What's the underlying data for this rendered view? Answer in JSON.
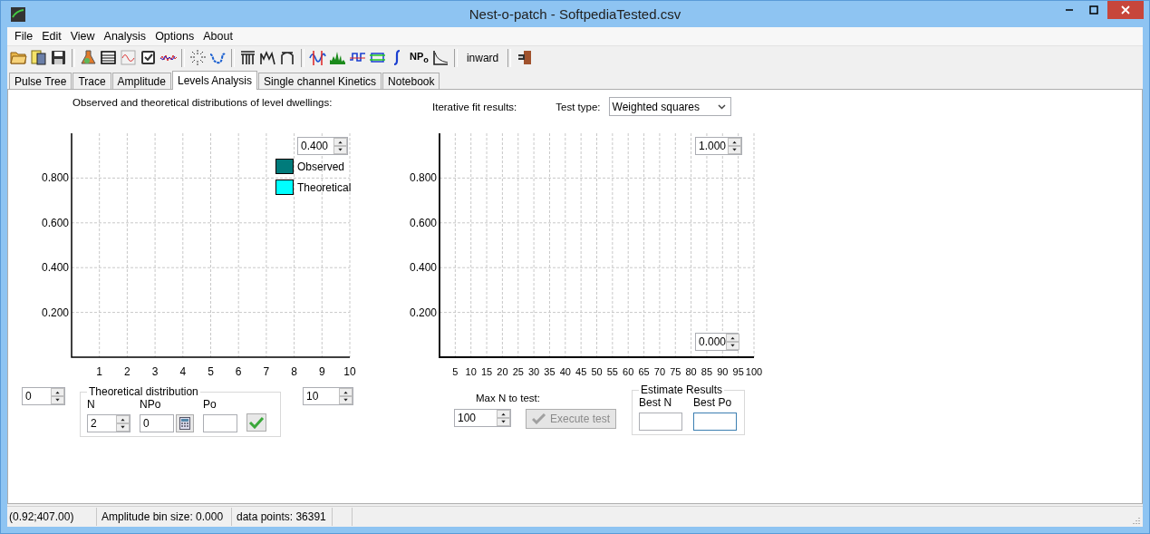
{
  "window": {
    "title": "Nest-o-patch - SoftpediaTested.csv"
  },
  "menu": [
    "File",
    "Edit",
    "View",
    "Analysis",
    "Options",
    "About"
  ],
  "toolbar": {
    "npo_button": "NP$_{o}$",
    "mode_button": "inward"
  },
  "tabs": [
    {
      "label": "Pulse Tree",
      "selected": false
    },
    {
      "label": "Trace",
      "selected": false
    },
    {
      "label": "Amplitude",
      "selected": false
    },
    {
      "label": "Levels Analysis",
      "selected": true
    },
    {
      "label": "Single channel Kinetics",
      "selected": false
    },
    {
      "label": "Notebook",
      "selected": false
    }
  ],
  "left_panel": {
    "heading": "Observed and theoretical distributions of level dwellings:",
    "chart_data": {
      "type": "bar",
      "grid": true,
      "xlim": [
        0,
        10
      ],
      "ylim": [
        0,
        1
      ],
      "xticks": [
        1,
        2,
        3,
        4,
        5,
        6,
        7,
        8,
        9,
        10
      ],
      "yticks": [
        {
          "value": 0.2,
          "label": "0.200"
        },
        {
          "value": 0.4,
          "label": "0.400"
        },
        {
          "value": 0.6,
          "label": "0.600"
        },
        {
          "value": 0.8,
          "label": "0.800"
        }
      ]
    },
    "y_max_spin": "0.400",
    "legend": [
      {
        "label": "Observed",
        "color": "#007b7b"
      },
      {
        "label": "Theoretical",
        "color": "#00ffff"
      }
    ],
    "x_min_spin": "0",
    "x_max_spin": "10",
    "theoretical_distribution": {
      "title": "Theoretical distribution",
      "n_label": "N",
      "n_value": "2",
      "npo_label": "NPo",
      "npo_value": "0",
      "po_label": "Po"
    }
  },
  "right_panel": {
    "heading": "Iterative fit results:",
    "test_type_label": "Test type:",
    "test_type": "Weighted squares",
    "chart_data": {
      "type": "line",
      "grid": true,
      "xlim": [
        0,
        100
      ],
      "ylim": [
        0,
        1
      ],
      "xticks": [
        5,
        10,
        15,
        20,
        25,
        30,
        35,
        40,
        45,
        50,
        55,
        60,
        65,
        70,
        75,
        80,
        85,
        90,
        95,
        100
      ],
      "yticks": [
        {
          "value": 0.2,
          "label": "0.200"
        },
        {
          "value": 0.4,
          "label": "0.400"
        },
        {
          "value": 0.6,
          "label": "0.600"
        },
        {
          "value": 0.8,
          "label": "0.800"
        }
      ]
    },
    "y_max_spin": "1.000",
    "y_min_spin": "0.000",
    "max_n_label": "Max N to test:",
    "max_n_value": "100",
    "execute_button": {
      "label": "Execute test",
      "disabled": true
    },
    "estimate_results": {
      "title": "Estimate Results",
      "best_n_label": "Best N",
      "best_n_focused": false,
      "best_po_label": "Best Po",
      "best_po_focused": true
    }
  },
  "status_bar": [
    "(0.92;407.00)",
    "Amplitude bin size: 0.000",
    "data points: 36391"
  ]
}
